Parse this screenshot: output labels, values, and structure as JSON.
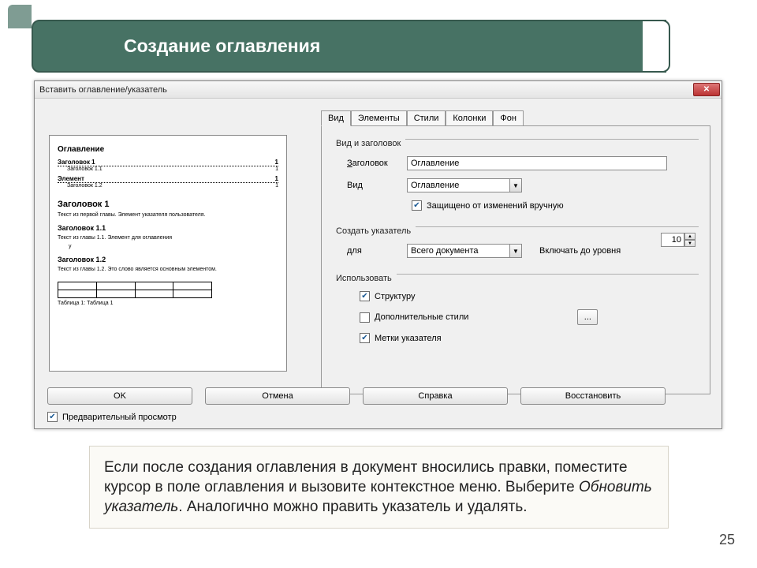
{
  "slide": {
    "title": "Создание оглавления",
    "page": "25"
  },
  "dialog": {
    "title": "Вставить оглавление/указатель",
    "tabs": [
      "Вид",
      "Элементы",
      "Стили",
      "Колонки",
      "Фон"
    ],
    "groups": {
      "g1": "Вид и заголовок",
      "g2": "Создать указатель",
      "g3": "Использовать"
    },
    "fields": {
      "heading_label": "Заголовок",
      "heading_acc": "З",
      "heading_value": "Оглавление",
      "type_label": "Вид",
      "type_value": "Оглавление",
      "protected_label": "Защищено от изменений вручную",
      "protected_acc": "З",
      "for_label": "для",
      "for_value": "Всего документа",
      "levels_label": "Включать до уровня",
      "levels_value": "10",
      "use_structure": "Структуру",
      "use_structure_acc": "С",
      "use_addstyles": "Дополнительные стили",
      "use_marks": "Метки указателя",
      "use_marks_acc": "М",
      "more": "..."
    },
    "buttons": {
      "ok": "OK",
      "cancel": "Отмена",
      "help": "Справка",
      "reset": "Восстановить"
    },
    "preview_label": "Предварительный просмотр",
    "preview_acc": "П",
    "preview": {
      "title": "Оглавление",
      "e1": "Заголовок 1",
      "p1": "1",
      "e1a": "Заголовок 1.1",
      "p1a": "1",
      "e2": "Элемент",
      "p2": "1",
      "e2a": "Заголовок 1.2",
      "p2a": "1",
      "h1": "Заголовок 1",
      "t1": "Текст из первой главы. Элемент указателя пользователя.",
      "h11": "Заголовок 1.1",
      "t11a": "Текст из главы 1.1. Элемент для оглавления",
      "t11b": "у",
      "h12": "Заголовок 1.2",
      "t12": "Текст из главы 1.2. Это слово является основным элементом.",
      "caption": "Таблица 1: Таблица 1"
    }
  },
  "note": {
    "text": "Если после создания оглавления в документ вносились правки, поместите курсор в поле оглавления и вызовите контекстное меню. Выберите ",
    "emph": "Обновить указатель",
    "tail": ". Аналогично можно править указатель и удалять."
  }
}
